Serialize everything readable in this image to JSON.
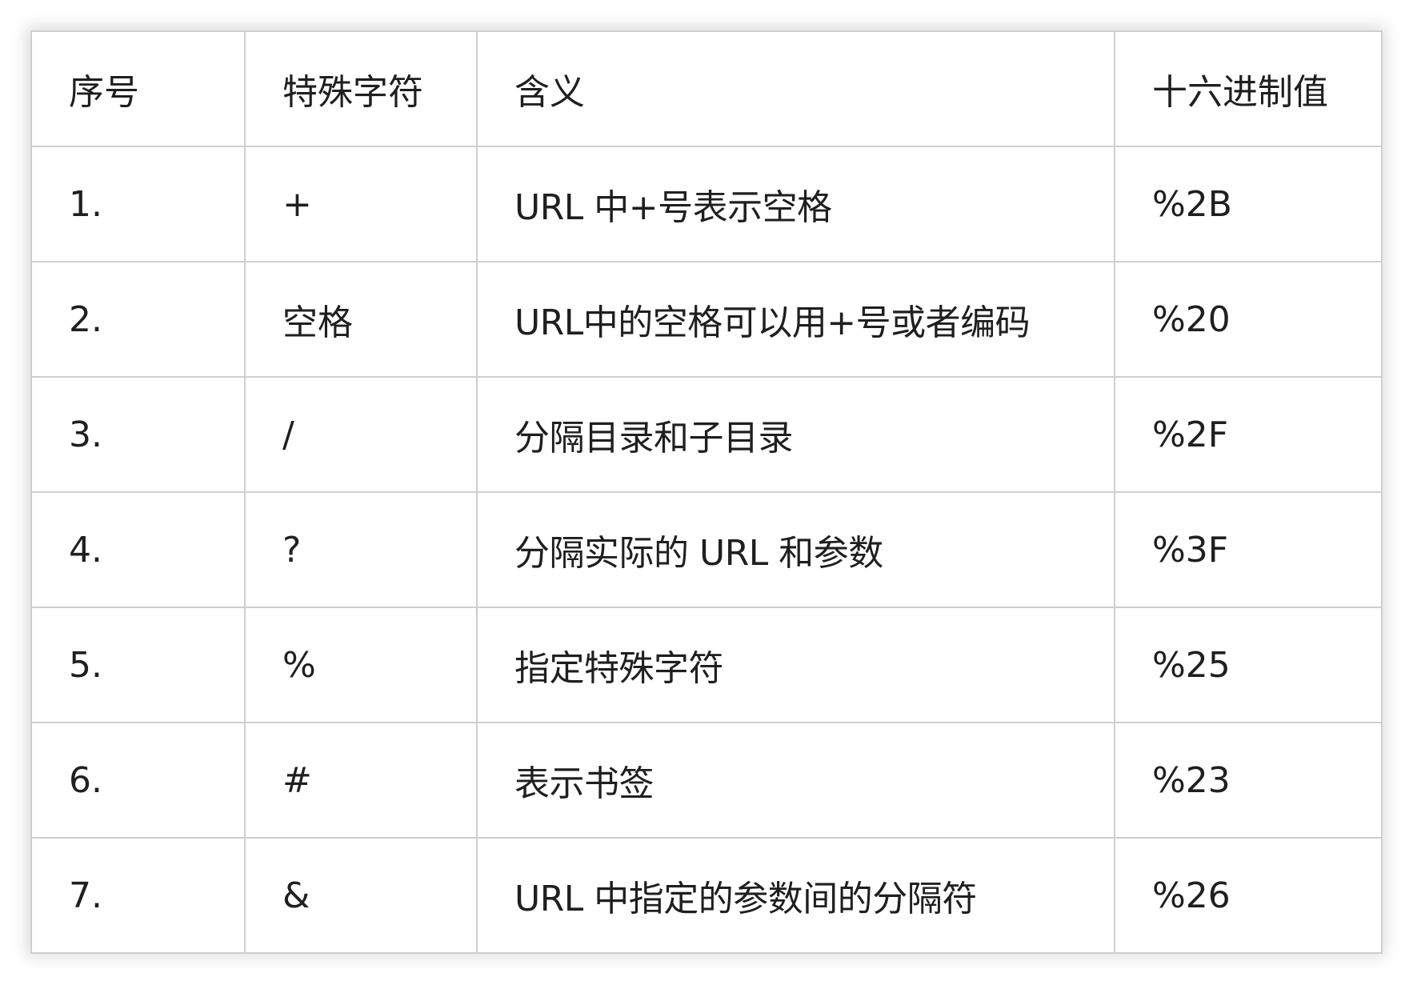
{
  "table": {
    "headers": [
      "序号",
      "特殊字符",
      "含义",
      "十六进制值"
    ],
    "rows": [
      [
        "1.",
        "+",
        "URL 中+号表示空格",
        "%2B"
      ],
      [
        "2.",
        "空格",
        "URL中的空格可以用+号或者编码",
        "%20"
      ],
      [
        "3.",
        "/",
        "分隔目录和子目录",
        "%2F"
      ],
      [
        "4.",
        "?",
        "分隔实际的 URL 和参数",
        "%3F"
      ],
      [
        "5.",
        "%",
        "指定特殊字符",
        "%25"
      ],
      [
        "6.",
        "#",
        "表示书签",
        "%23"
      ],
      [
        "7.",
        "&",
        "URL 中指定的参数间的分隔符",
        "%26"
      ]
    ]
  }
}
